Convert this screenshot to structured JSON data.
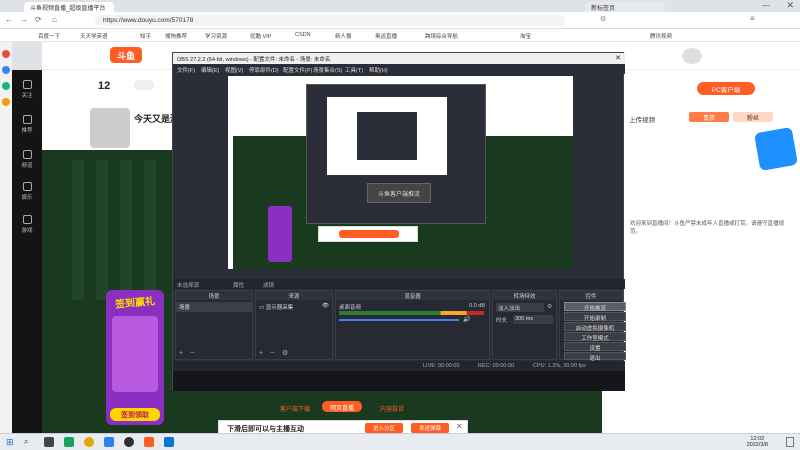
{
  "browser": {
    "tabs": [
      "斗鱼视频直播_超级直播平台",
      "新标签页"
    ],
    "url": "https://www.douyu.com/570178",
    "bookmarks": [
      "百度一下",
      "天天学英语",
      "知乎",
      "搜狗推荐",
      "学习资源",
      "优酷 VIP",
      "CSDN",
      "新人报",
      "奥运直播",
      "跨境综合导航",
      "淘宝",
      "腾讯视频"
    ]
  },
  "douyu": {
    "logo": "斗鱼",
    "fans_count": "12",
    "stream_title": "今天又是激情...",
    "sidebar": [
      "关注",
      "推荐",
      "频道",
      "娱乐",
      "游戏"
    ],
    "pc_client": "PC客户端",
    "upload_section": "上传视频",
    "right_tabs": [
      "贵族",
      "粉丝"
    ],
    "chat_notice": "欢迎来到直播间！斗鱼严禁未成年人直播或打赏，请遵守直播规范。",
    "promo_title": "签到赢礼",
    "promo_button": "签到领取",
    "bottom_links": [
      "客户端下载",
      "网页直播",
      "内容投诉"
    ],
    "ad_text": "下滑后即可以与主播互动",
    "ad_button1": "进入分区",
    "ad_button2": "发送弹幕"
  },
  "obs": {
    "title": "OBS 27.2.2 (64-bit, windows) - 配置文件: 未命名 - 场景: 未命名",
    "menu": [
      "文件(F)",
      "编辑(E)",
      "视图(V)",
      "停靠部件(D)",
      "配置文件(P)",
      "场景集合(S)",
      "工具(T)",
      "帮助(H)"
    ],
    "status_msg": "未选择源",
    "properties_label": "属性",
    "filters_label": "滤镜",
    "docks": {
      "scenes": {
        "title": "场景",
        "item": "场景"
      },
      "sources": {
        "title": "来源",
        "item": "显示器采集"
      },
      "mixer": {
        "title": "混音器",
        "track": "桌面音频",
        "level": "0.0 dB"
      },
      "transitions": {
        "title": "转场特效",
        "type": "淡入淡出",
        "duration_label": "时长",
        "duration": "300 ms"
      },
      "controls": {
        "title": "控件",
        "buttons": [
          "开始推流",
          "开始录制",
          "启动虚拟摄像机",
          "工作室模式",
          "设置",
          "退出"
        ]
      }
    },
    "statusbar": [
      "LIVE: 00:00:00",
      "REC: 00:00:00",
      "CPU: 1.3%, 30.00 fps"
    ],
    "nested_caption": "斗鱼客户端推流"
  },
  "taskbar": {
    "time": "12:02",
    "date": "2022/3/8"
  },
  "colors": {
    "douyu_orange": "#ff5d23",
    "obs_bg": "#2b2e38",
    "stage_green": "#1a3a20"
  }
}
